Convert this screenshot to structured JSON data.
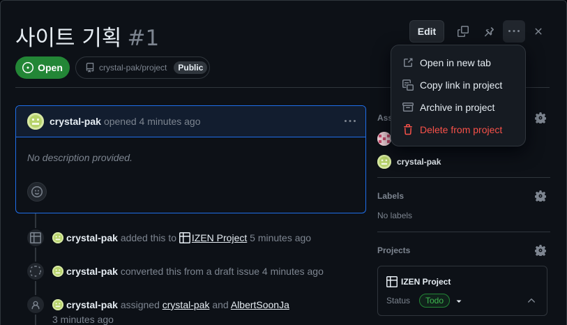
{
  "header": {
    "title": "사이트 기획",
    "issue_number": "#1",
    "edit_label": "Edit",
    "icons": [
      "copy-icon",
      "pin-icon",
      "kebab-horizontal-icon",
      "close-icon"
    ]
  },
  "status": {
    "state_label": "Open",
    "repo": "crystal-pak/project",
    "visibility": "Public"
  },
  "comment": {
    "author": "crystal-pak",
    "action": "opened 4 minutes ago",
    "body": "No description provided."
  },
  "timeline": [
    {
      "icon": "table-icon",
      "actor": "crystal-pak",
      "text_before": "added this to",
      "link": "IZEN Project",
      "text_after": "5 minutes ago"
    },
    {
      "icon": "draft-issue-icon",
      "actor": "crystal-pak",
      "text_before": "converted this from a draft issue 4 minutes ago"
    },
    {
      "icon": "person-icon",
      "actor": "crystal-pak",
      "text_before": "assigned",
      "link": "crystal-pak",
      "and": "and",
      "link2": "AlbertSoonJa",
      "text_after": "3 minutes ago"
    }
  ],
  "sidebar": {
    "assignees_label": "Ass",
    "assignees": [
      "crystal-pak"
    ],
    "labels_label": "Labels",
    "labels_value": "No labels",
    "projects_label": "Projects",
    "project": {
      "name": "IZEN Project",
      "status_label": "Status",
      "status_value": "Todo"
    }
  },
  "menu": {
    "items": [
      {
        "label": "Open in new tab",
        "icon": "link-external-icon"
      },
      {
        "label": "Copy link in project",
        "icon": "copy-link-icon"
      },
      {
        "label": "Archive in project",
        "icon": "archive-icon"
      },
      {
        "label": "Delete from project",
        "icon": "trash-icon"
      }
    ]
  },
  "colors": {
    "accent_green": "#238636",
    "focus_blue": "#1f6feb",
    "danger_red": "#f85149",
    "background": "#0d1117"
  }
}
